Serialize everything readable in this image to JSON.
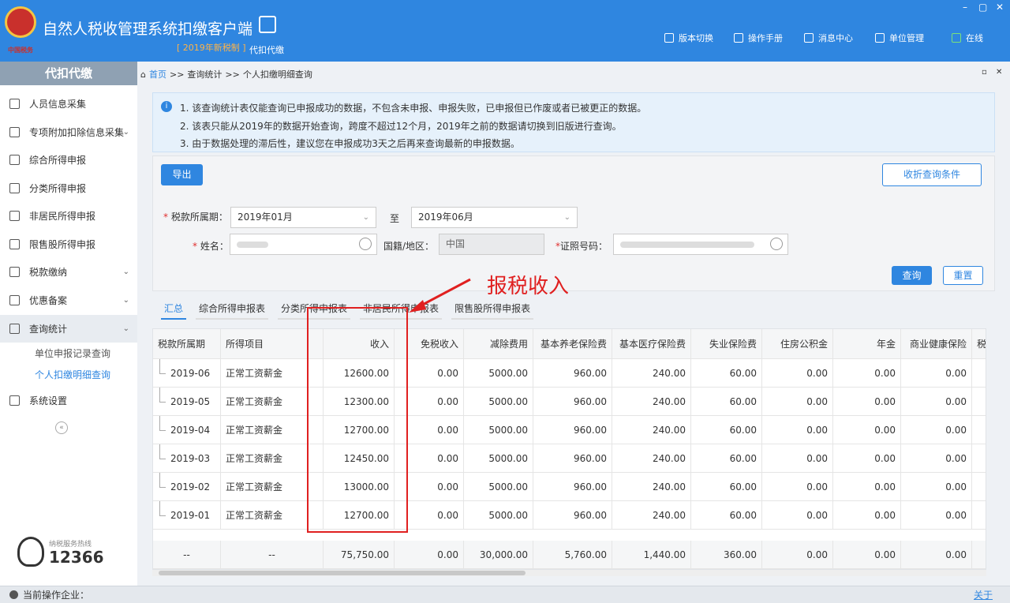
{
  "app": {
    "title": "自然人税收管理系统扣缴客户端",
    "subtitle": "[ 2019年新税制 ]",
    "module": "代扣代缴",
    "emblem_text": "中国税务"
  },
  "topnav": [
    {
      "label": "版本切换",
      "icon": "document-icon"
    },
    {
      "label": "操作手册",
      "icon": "manual-icon"
    },
    {
      "label": "消息中心",
      "icon": "mail-icon"
    },
    {
      "label": "单位管理",
      "icon": "building-icon"
    },
    {
      "label": "在线",
      "icon": "online-icon",
      "color": "#7ae27a"
    }
  ],
  "window_controls": {
    "minimize": "–",
    "restore": "▢",
    "close": "✕"
  },
  "sidebar": {
    "header": "代扣代缴",
    "items": [
      {
        "label": "人员信息采集",
        "icon": "person-icon"
      },
      {
        "label": "专项附加扣除信息采集",
        "icon": "list-icon",
        "chevron": "⌄"
      },
      {
        "label": "综合所得申报",
        "icon": "layers-icon"
      },
      {
        "label": "分类所得申报",
        "icon": "pie-icon"
      },
      {
        "label": "非居民所得申报",
        "icon": "user-icon"
      },
      {
        "label": "限售股所得申报",
        "icon": "bar-chart-icon"
      },
      {
        "label": "税款缴纳",
        "icon": "wallet-icon",
        "chevron": "⌄"
      },
      {
        "label": "优惠备案",
        "icon": "file-icon",
        "chevron": "⌄"
      },
      {
        "label": "查询统计",
        "icon": "query-icon",
        "chevron": "⌄"
      }
    ],
    "subitems": [
      {
        "label": "单位申报记录查询"
      },
      {
        "label": "个人扣缴明细查询",
        "selected": true
      }
    ],
    "settings": "系统设置",
    "collapse": "«",
    "hotline_caption": "纳税服务热线",
    "hotline_number": "12366"
  },
  "breadcrumb": {
    "home": "首页",
    "sep": ">>",
    "level1": "查询统计",
    "level2": "个人扣缴明细查询"
  },
  "notice": {
    "lines": [
      "1. 该查询统计表仅能查询已申报成功的数据，不包含未申报、申报失败，已申报但已作废或者已被更正的数据。",
      "2. 该表只能从2019年的数据开始查询，跨度不超过12个月，2019年之前的数据请切换到旧版进行查询。",
      "3. 由于数据处理的滞后性，建议您在申报成功3天之后再来查询最新的申报数据。"
    ]
  },
  "toolbar": {
    "export": "导出",
    "collapse_filters": "收折查询条件"
  },
  "form": {
    "period_label": "税款所属期：",
    "period_from": "2019年01月",
    "to_label": "至",
    "period_to": "2019年06月",
    "name_label": "姓名：",
    "nationality_label": "国籍/地区：",
    "nationality_value": "中国",
    "id_label": "证照号码：",
    "query": "查询",
    "reset": "重置"
  },
  "annotation": {
    "text": "报税收入"
  },
  "tabs": [
    "汇总",
    "综合所得申报表",
    "分类所得申报表",
    "非居民所得申报表",
    "限售股所得申报表"
  ],
  "table": {
    "headers": [
      "税款所属期",
      "所得项目",
      "收入",
      "免税收入",
      "减除费用",
      "基本养老保险费",
      "基本医疗保险费",
      "失业保险费",
      "住房公积金",
      "年金",
      "商业健康保险",
      "税"
    ],
    "rows": [
      [
        "2019-06",
        "正常工资薪金",
        "12600.00",
        "0.00",
        "5000.00",
        "960.00",
        "240.00",
        "60.00",
        "0.00",
        "0.00",
        "0.00"
      ],
      [
        "2019-05",
        "正常工资薪金",
        "12300.00",
        "0.00",
        "5000.00",
        "960.00",
        "240.00",
        "60.00",
        "0.00",
        "0.00",
        "0.00"
      ],
      [
        "2019-04",
        "正常工资薪金",
        "12700.00",
        "0.00",
        "5000.00",
        "960.00",
        "240.00",
        "60.00",
        "0.00",
        "0.00",
        "0.00"
      ],
      [
        "2019-03",
        "正常工资薪金",
        "12450.00",
        "0.00",
        "5000.00",
        "960.00",
        "240.00",
        "60.00",
        "0.00",
        "0.00",
        "0.00"
      ],
      [
        "2019-02",
        "正常工资薪金",
        "13000.00",
        "0.00",
        "5000.00",
        "960.00",
        "240.00",
        "60.00",
        "0.00",
        "0.00",
        "0.00"
      ],
      [
        "2019-01",
        "正常工资薪金",
        "12700.00",
        "0.00",
        "5000.00",
        "960.00",
        "240.00",
        "60.00",
        "0.00",
        "0.00",
        "0.00"
      ]
    ],
    "totals": [
      "--",
      "--",
      "75,750.00",
      "0.00",
      "30,000.00",
      "5,760.00",
      "1,440.00",
      "360.00",
      "0.00",
      "0.00",
      "0.00"
    ]
  },
  "statusbar": {
    "label": "当前操作企业：",
    "about": "关于"
  }
}
